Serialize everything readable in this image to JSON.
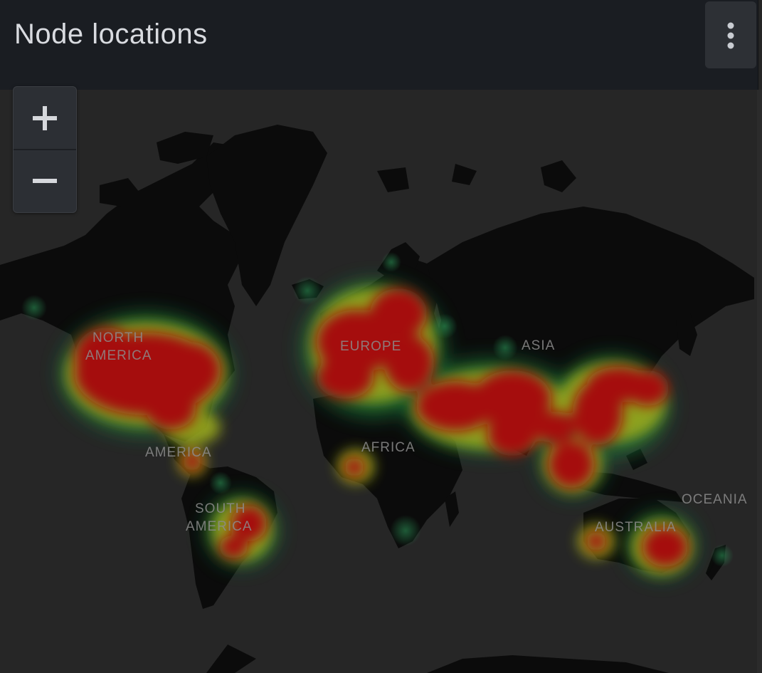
{
  "panel": {
    "title": "Node locations",
    "menu_icon": "vertical-ellipsis-icon"
  },
  "zoom": {
    "zoom_in_label": "+",
    "zoom_out_label": "−"
  },
  "map": {
    "type": "heatmap",
    "colors": {
      "background": "#262626",
      "land": "#0b0b0b",
      "heat_low": "#1f7a3a",
      "heat_mid": "#9aa81e",
      "heat_high": "#a50f0a"
    },
    "region_labels": {
      "north_america_1": "NORTH",
      "north_america_2": "AMERICA",
      "central_america": "AMERICA",
      "south_america_1": "SOUTH",
      "south_america_2": "AMERICA",
      "europe": "EUROPE",
      "asia": "ASIA",
      "africa": "AFRICA",
      "oceania": "OCEANIA",
      "australia": "AUSTRALIA"
    }
  }
}
